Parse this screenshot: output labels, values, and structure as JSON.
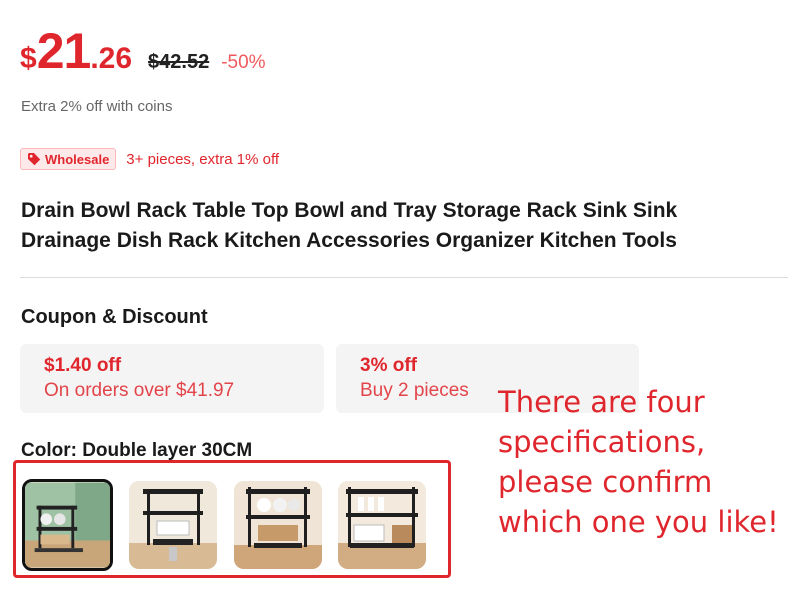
{
  "price": {
    "currency": "$",
    "integer": "21",
    "decimal": ".26",
    "original": "$42.52",
    "discount": "-50%"
  },
  "coins_text": "Extra 2% off with coins",
  "wholesale": {
    "badge_label": "Wholesale",
    "text": "3+ pieces, extra 1% off",
    "icon": "tag-icon"
  },
  "product_title": "Drain Bowl Rack Table Top Bowl and Tray Storage Rack Sink Sink Drainage Dish Rack Kitchen Accessories Organizer Kitchen Tools",
  "coupon_section": {
    "heading": "Coupon & Discount",
    "coupons": [
      {
        "amount": "$1.40 off",
        "condition": "On orders over $41.97"
      },
      {
        "amount": "3% off",
        "condition": "Buy 2 pieces"
      }
    ]
  },
  "color": {
    "label": "Color: Double layer 30CM",
    "selected_index": 0
  },
  "annotation_text": "There are four specifications, please confirm which one you like!",
  "colors": {
    "accent": "#e0262d",
    "badge_bg": "#fde9ea",
    "coupon_bg": "#f4f4f4"
  }
}
